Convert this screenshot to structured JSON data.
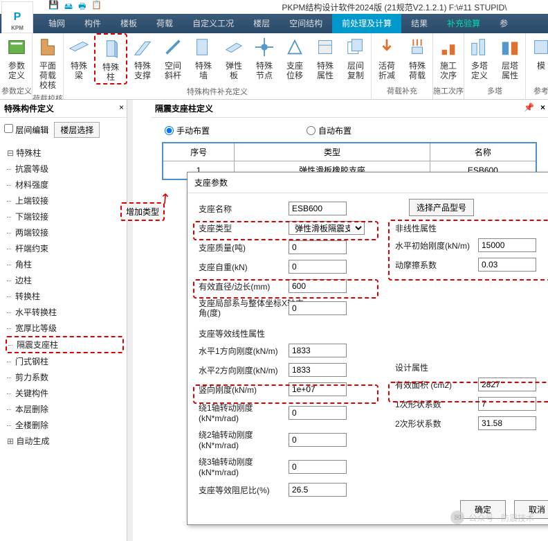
{
  "title": "PKPM结构设计软件2024版 (21规范V2.1.2.1) F:\\#11 STUPID\\",
  "qicons": [
    "💾",
    "🖴",
    "🖶",
    "📋"
  ],
  "tabs": [
    "轴网",
    "构件",
    "楼板",
    "荷载",
    "自定义工况",
    "楼层",
    "空间结构",
    "前处理及计算",
    "结果",
    "补充验算",
    "参"
  ],
  "tabs_active": 7,
  "ribbon": {
    "g1": {
      "label": "参数定义",
      "btns": [
        {
          "l1": "参数",
          "l2": "定义"
        }
      ]
    },
    "g2": {
      "label": "荷载校核",
      "btns": [
        {
          "l1": "平面荷载",
          "l2": "校核"
        }
      ]
    },
    "g3": {
      "label": "特殊构件补充定义",
      "btns": [
        {
          "l1": "特殊",
          "l2": "梁"
        },
        {
          "l1": "特殊",
          "l2": "柱",
          "hl": true
        },
        {
          "l1": "特殊",
          "l2": "支撑"
        },
        {
          "l1": "空间",
          "l2": "斜杆"
        },
        {
          "l1": "特殊",
          "l2": "墙"
        },
        {
          "l1": "弹性",
          "l2": "板"
        },
        {
          "l1": "特殊",
          "l2": "节点"
        },
        {
          "l1": "支座",
          "l2": "位移"
        },
        {
          "l1": "特殊",
          "l2": "属性"
        },
        {
          "l1": "层间",
          "l2": "复制"
        }
      ]
    },
    "g4": {
      "label": "荷载补充",
      "btns": [
        {
          "l1": "活荷",
          "l2": "折减"
        },
        {
          "l1": "特殊",
          "l2": "荷载"
        }
      ]
    },
    "g5": {
      "label": "施工次序",
      "btns": [
        {
          "l1": "施工",
          "l2": "次序"
        }
      ]
    },
    "g6": {
      "label": "多塔",
      "btns": [
        {
          "l1": "多塔",
          "l2": "定义"
        },
        {
          "l1": "层塔",
          "l2": "属性"
        }
      ]
    },
    "g7": {
      "label": "参考",
      "btns": [
        {
          "l1": "模",
          "l2": ""
        }
      ]
    }
  },
  "left_panel": {
    "title": "特殊构件定义",
    "close": "×",
    "cb": "层间编辑",
    "btn": "楼层选择",
    "tree_head": "特殊柱",
    "tree": [
      "抗震等级",
      "材料强度",
      "上端铰接",
      "下端铰接",
      "两端铰接",
      "杆端约束",
      "角柱",
      "边柱",
      "转换柱",
      "水平转换柱",
      "宽厚比等级",
      "隔震支座柱",
      "门式钢柱",
      "剪力系数",
      "关键构件",
      "本层删除",
      "全楼删除"
    ],
    "tree_hl": 11,
    "tree_foot": "自动生成"
  },
  "right_panel": {
    "title": "隔震支座柱定义",
    "r1": "手动布置",
    "r2": "自动布置",
    "cols": [
      "序号",
      "类型",
      "名称"
    ],
    "row": [
      "1",
      "弹性滑板橡胶支座",
      "ESB600"
    ],
    "add_btn": "增加类型"
  },
  "dialog": {
    "title": "支座参数",
    "sel_btn": "选择产品型号",
    "f_name_l": "支座名称",
    "f_name_v": "ESB600",
    "f_type_l": "支座类型",
    "f_type_v": "弹性滑板隔震支",
    "f_mass_l": "支座质量(吨)",
    "f_mass_v": "0",
    "f_weight_l": "支座自重(kN)",
    "f_weight_v": "0",
    "f_diam_l": "有效直径/边长(mm)",
    "f_diam_v": "600",
    "f_ang_l": "支座局部系与整体坐标X轴夹角(度)",
    "f_ang_v": "0",
    "sect_lin": "支座等效线性属性",
    "f_h1_l": "水平1方向刚度(kN/m)",
    "f_h1_v": "1833",
    "f_h2_l": "水平2方向刚度(kN/m)",
    "f_h2_v": "1833",
    "f_vert_l": "竖向刚度(kN/m)",
    "f_vert_v": "1e+07",
    "f_r1_l": "绕1轴转动刚度(kN*m/rad)",
    "f_r1_v": "0",
    "f_r2_l": "绕2轴转动刚度(kN*m/rad)",
    "f_r2_v": "0",
    "f_r3_l": "绕3轴转动刚度(kN*m/rad)",
    "f_r3_v": "0",
    "f_damp_l": "支座等效阻尼比(%)",
    "f_damp_v": "26.5",
    "sect_nl": "非线性属性",
    "f_init_l": "水平初始刚度(kN/m)",
    "f_init_v": "15000",
    "f_fric_l": "动摩擦系数",
    "f_fric_v": "0.03",
    "sect_des": "设计属性",
    "f_area_l": "有效面积 (cm2)",
    "f_area_v": "2827",
    "f_s1_l": "1次形状系数",
    "f_s1_v": "7",
    "f_s2_l": "2次形状系数",
    "f_s2_v": "31.58",
    "ok": "确定",
    "cancel": "取消"
  },
  "watermark": "公众号 · 防震技术"
}
